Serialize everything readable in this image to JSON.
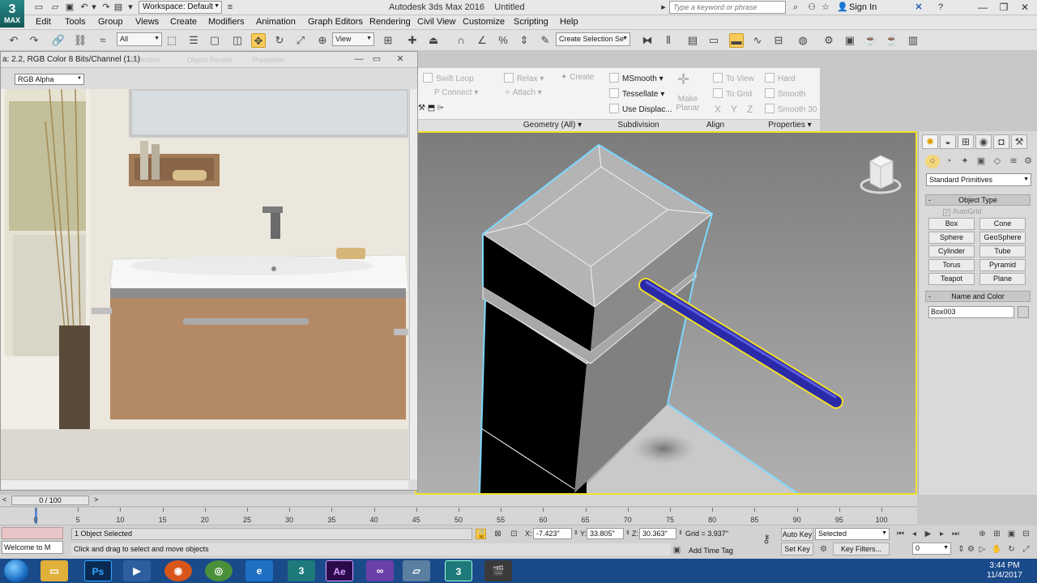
{
  "titlebar": {
    "logo_label": "MAX",
    "workspace": "Workspace: Default",
    "app_title": "Autodesk 3ds Max 2016",
    "doc_title": "Untitled",
    "search_placeholder": "Type a keyword or phrase",
    "sign_in": "Sign In"
  },
  "menu": [
    "Edit",
    "Tools",
    "Group",
    "Views",
    "Create",
    "Modifiers",
    "Animation",
    "Graph Editors",
    "Rendering",
    "Civil View",
    "Customize",
    "Scripting",
    "Help"
  ],
  "toolbar": {
    "selection_filter": "All",
    "ref_coord": "View",
    "named_selection": "Create Selection Se"
  },
  "ribbon": {
    "swift_loop": "Swift Loop",
    "p_connect": "P Connect",
    "relax": "Relax",
    "create": "Create",
    "attach": "Attach",
    "msmooth": "MSmooth",
    "tessellate": "Tessellate",
    "use_displace": "Use Displac...",
    "make_planar": "Make Planar",
    "to_view": "To View",
    "to_grid": "To Grid",
    "x": "X",
    "y": "Y",
    "z": "Z",
    "hard": "Hard",
    "smooth": "Smooth",
    "smooth30": "Smooth 30",
    "groups": {
      "geometry": "Geometry (All)",
      "subdivision": "Subdivision",
      "align": "Align",
      "properties": "Properties"
    }
  },
  "frame_buffer": {
    "title": "a: 2.2, RGB Color 8 Bits/Channel (1:1)",
    "ghost_text_1": "Selection",
    "ghost_text_2": "Object Panels",
    "ghost_text_3": "Presenter",
    "channel": "RGB Alpha"
  },
  "command_panel": {
    "category": "Standard Primitives",
    "object_type_title": "Object Type",
    "autogrid": "AutoGrid",
    "primitives": [
      "Box",
      "Cone",
      "Sphere",
      "GeoSphere",
      "Cylinder",
      "Tube",
      "Torus",
      "Pyramid",
      "Teapot",
      "Plane"
    ],
    "name_color_title": "Name and Color",
    "object_name": "Box003"
  },
  "timeline": {
    "frame_readout": "0 / 100",
    "ticks": [
      "0",
      "5",
      "10",
      "15",
      "20",
      "25",
      "30",
      "35",
      "40",
      "45",
      "50",
      "55",
      "60",
      "65",
      "70",
      "75",
      "80",
      "85",
      "90",
      "95",
      "100"
    ]
  },
  "status": {
    "listener_text": "Welcome to M",
    "selection": "1 Object Selected",
    "prompt": "Click and drag to select and move objects",
    "x_label": "X:",
    "x_value": "-7.423\"",
    "y_label": "Y:",
    "y_value": "33.805\"",
    "z_label": "Z:",
    "z_value": "30.363\"",
    "grid": "Grid = 3.937\"",
    "add_time_tag": "Add Time Tag",
    "auto_key": "Auto Key",
    "set_key": "Set Key",
    "key_mode": "Selected",
    "key_filters": "Key Filters...",
    "frame_field": "0"
  },
  "taskbar": {
    "photoshop": "Ps",
    "after_effects": "Ae",
    "time": "3:44 PM",
    "date": "11/4/2017"
  },
  "colors": {
    "viewport_border": "#f2e02a",
    "selection_outline": "#7fd8ff",
    "cylinder": "#2a2aa8",
    "active_tool": "#f9cc5a"
  }
}
